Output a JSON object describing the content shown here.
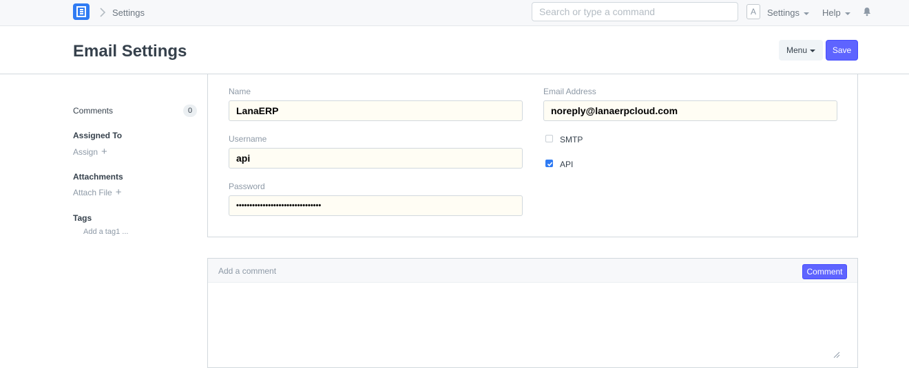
{
  "navbar": {
    "breadcrumb": "Settings",
    "search_placeholder": "Search or type a command",
    "avatar_letter": "A",
    "settings_label": "Settings",
    "help_label": "Help"
  },
  "page": {
    "title": "Email Settings",
    "menu_label": "Menu",
    "save_label": "Save"
  },
  "sidebar": {
    "comments_label": "Comments",
    "comments_count": "0",
    "assigned_to_label": "Assigned To",
    "assign_label": "Assign",
    "attachments_label": "Attachments",
    "attach_file_label": "Attach File",
    "tags_label": "Tags",
    "add_tag_label": "Add a tag1 ..."
  },
  "form": {
    "name_label": "Name",
    "name_value": "LanaERP",
    "username_label": "Username",
    "username_value": "api",
    "password_label": "Password",
    "password_value": "••••••••••••••••••••••••••••••••",
    "email_label": "Email Address",
    "email_value": "noreply@lanaerpcloud.com",
    "smtp_label": "SMTP",
    "smtp_checked": false,
    "api_label": "API",
    "api_checked": true
  },
  "comment": {
    "placeholder": "Add a comment",
    "button_label": "Comment"
  },
  "colors": {
    "primary": "#5e64ff",
    "logo": "#2f7bf3",
    "input_bg": "#fffdf4"
  }
}
